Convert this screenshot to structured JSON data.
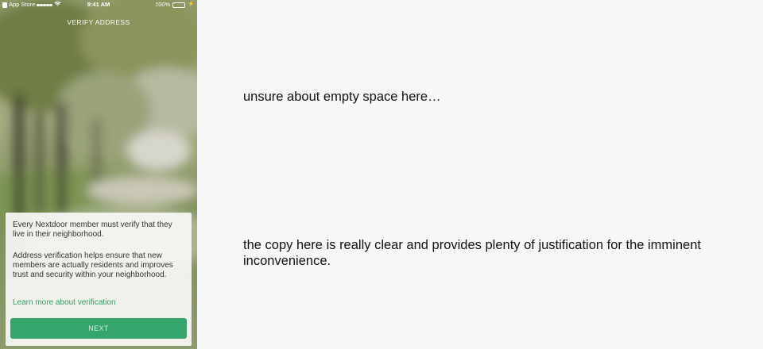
{
  "status_bar": {
    "carrier": "App Store",
    "time": "9:41 AM",
    "battery_text": "100%",
    "icons": [
      "back-app-icon",
      "signal-icon",
      "wifi-icon",
      "battery-icon",
      "charging-icon"
    ]
  },
  "screen": {
    "title": "VERIFY ADDRESS",
    "card": {
      "paragraph_1": "Every Nextdoor member must verify that they live in their neighborhood.",
      "paragraph_2": "Address verification helps ensure that new members are actually residents and improves trust and security within your neighborhood.",
      "link": "Learn more about verification",
      "button": "NEXT"
    }
  },
  "annotations": {
    "note_1": "unsure about empty space here…",
    "note_2": "the copy here is really clear and provides plenty of justification for the imminent inconvenience."
  },
  "colors": {
    "accent": "#35a56b",
    "link": "#2f9e63",
    "battery": "#4cd964",
    "page_background": "#f8f8f8"
  }
}
